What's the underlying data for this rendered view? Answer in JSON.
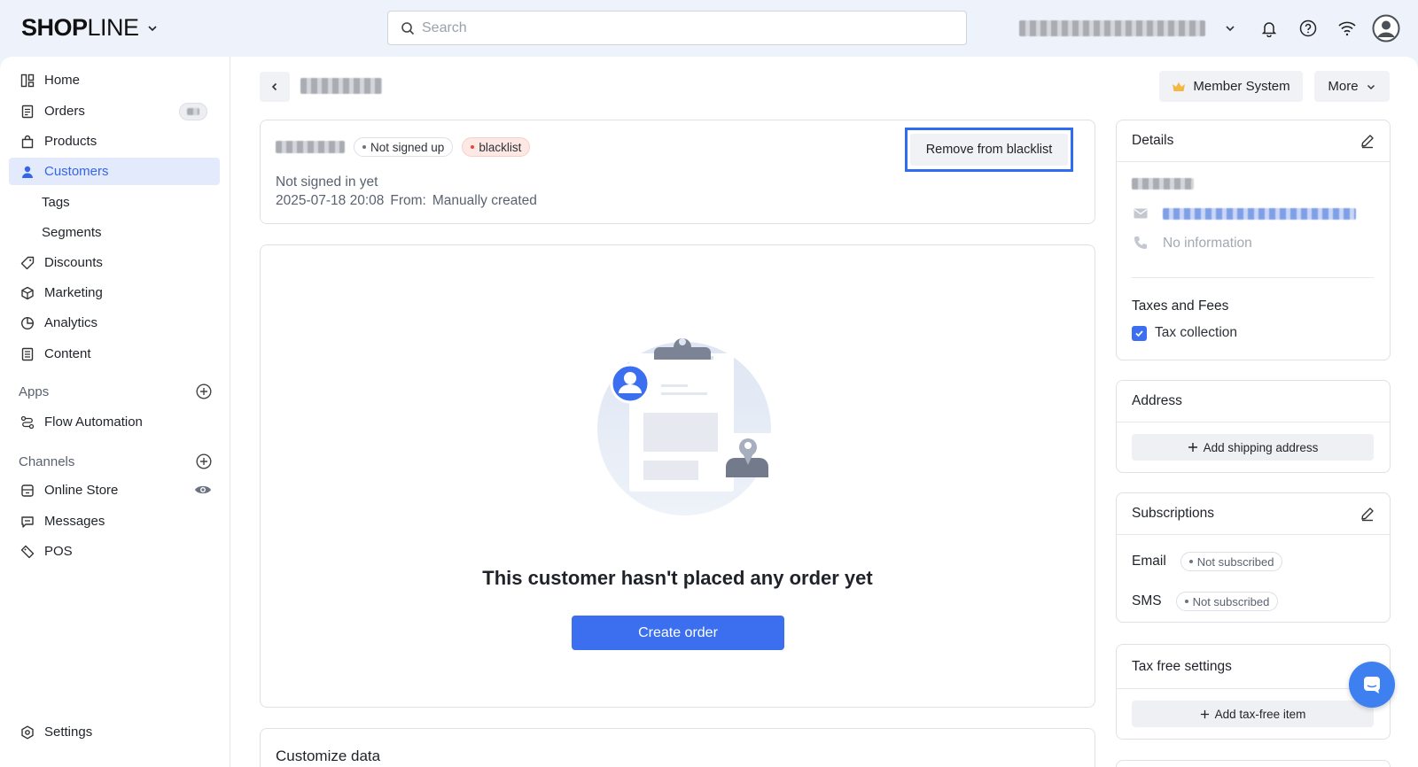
{
  "header": {
    "brand_bold": "SHOP",
    "brand_thin": "LINE",
    "search_placeholder": "Search"
  },
  "sidebar": {
    "items": [
      {
        "label": "Home",
        "icon": "home-icon"
      },
      {
        "label": "Orders",
        "icon": "orders-icon"
      },
      {
        "label": "Products",
        "icon": "bag-icon"
      },
      {
        "label": "Customers",
        "icon": "user-icon"
      },
      {
        "label": "Tags"
      },
      {
        "label": "Segments"
      },
      {
        "label": "Discounts",
        "icon": "tag-icon"
      },
      {
        "label": "Marketing",
        "icon": "cube-icon"
      },
      {
        "label": "Analytics",
        "icon": "pie-icon"
      },
      {
        "label": "Content",
        "icon": "document-icon"
      }
    ],
    "apps_label": "Apps",
    "flow_label": "Flow Automation",
    "channels_label": "Channels",
    "channels": [
      "Online Store",
      "Messages",
      "POS"
    ],
    "settings_label": "Settings"
  },
  "toolbar": {
    "member_system": "Member System",
    "more": "More"
  },
  "profile": {
    "chip_signup": "Not signed up",
    "chip_blacklist": "blacklist",
    "signed_in": "Not signed in yet",
    "created_date": "2025-07-18 20:08",
    "from_label": "From:",
    "from_value": "Manually created",
    "remove_button": "Remove from blacklist"
  },
  "orders": {
    "empty_title": "This customer hasn't placed any order yet",
    "create_button": "Create order"
  },
  "customize": {
    "title": "Customize data"
  },
  "details": {
    "title": "Details",
    "phone": "No information",
    "taxes_title": "Taxes and Fees",
    "tax_collection": "Tax collection",
    "tax_collection_checked": true
  },
  "address": {
    "title": "Address",
    "add_button": "Add shipping address"
  },
  "subscriptions": {
    "title": "Subscriptions",
    "email_label": "Email",
    "email_status": "Not subscribed",
    "sms_label": "SMS",
    "sms_status": "Not subscribed"
  },
  "taxfree": {
    "title": "Tax free settings",
    "add_button": "Add tax-free item"
  },
  "colors": {
    "accent": "#3b6ff0",
    "active_nav_bg": "#e3eafc",
    "highlight_border": "#2f6cf0",
    "blacklist_dot": "#e5483a"
  }
}
